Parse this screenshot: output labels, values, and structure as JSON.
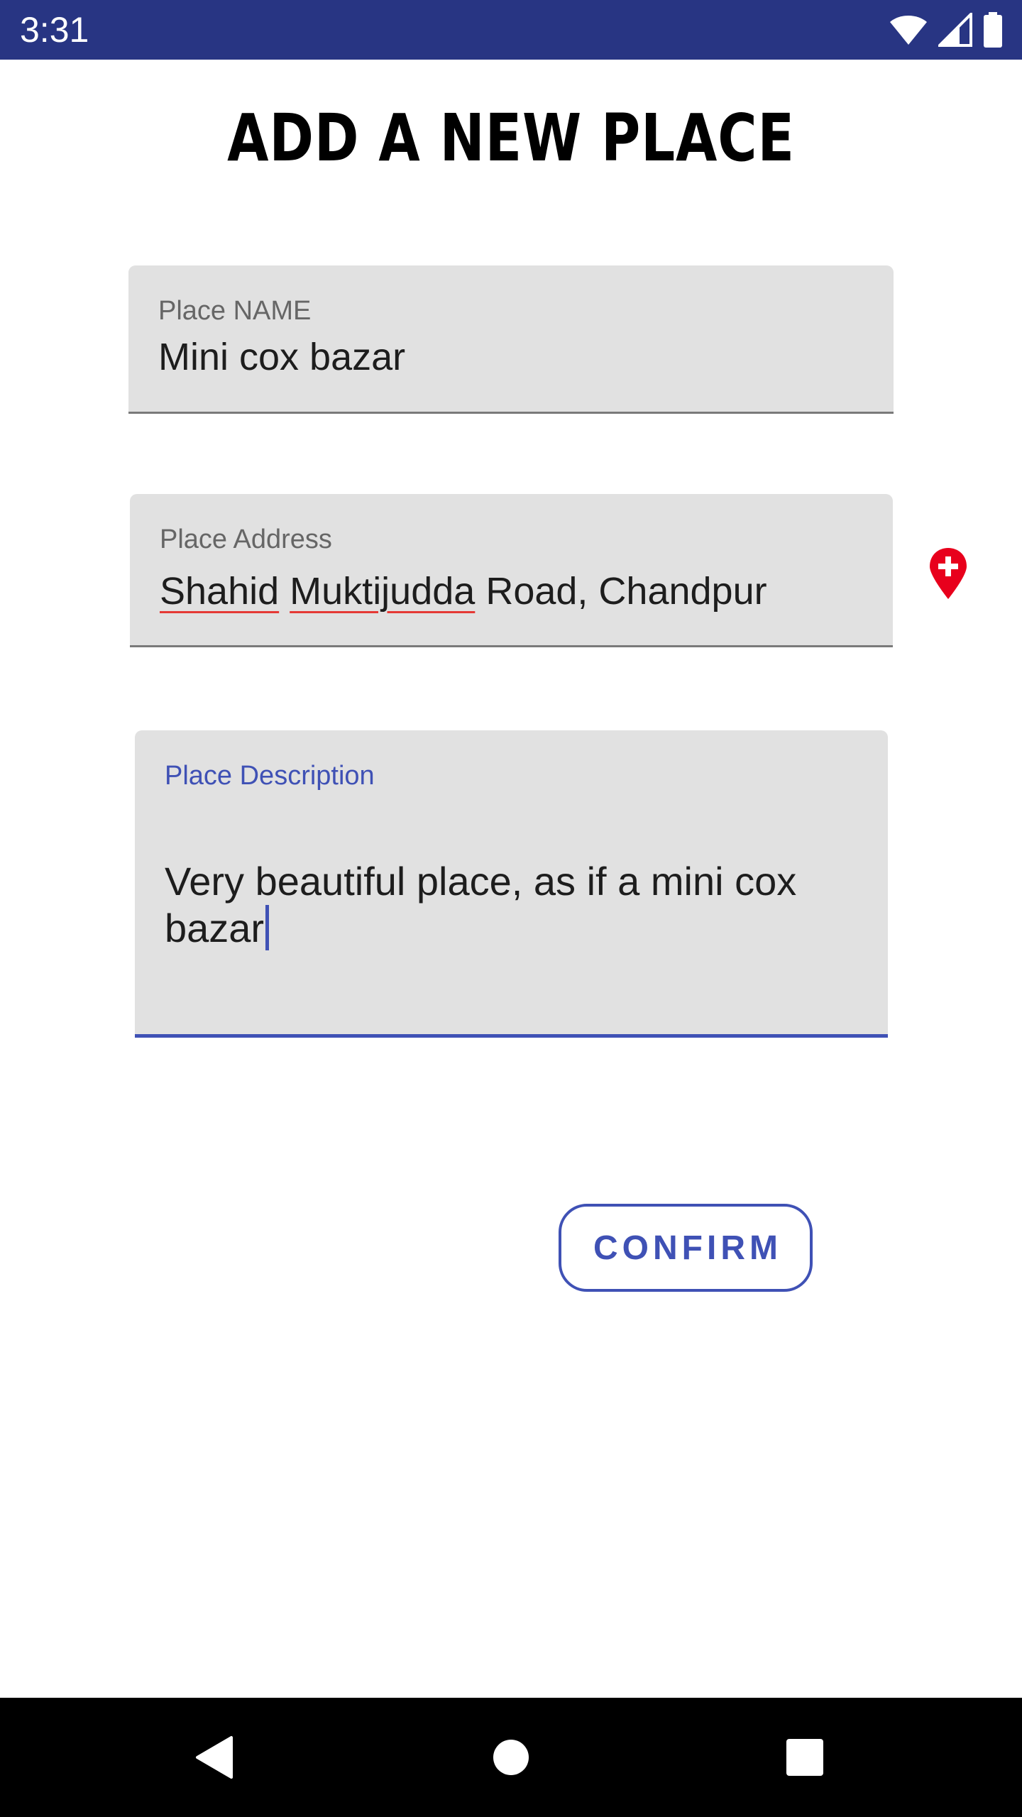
{
  "status_bar": {
    "time": "3:31",
    "icons": [
      "wifi-icon",
      "signal-icon",
      "battery-icon"
    ],
    "background": "#283583"
  },
  "title": "ADD A NEW PLACE",
  "name_field": {
    "label": "Place NAME",
    "value": "Mini cox bazar"
  },
  "address_field": {
    "label": "Place Address",
    "value_parts": [
      "Shahid",
      "Muktijudda",
      "Road, Chandpur"
    ],
    "pin_icon": "add-location-icon",
    "pin_color": "#e8001c"
  },
  "description_field": {
    "label": "Place Description",
    "value": "Very beautiful place, as if a mini cox bazar",
    "focused": true,
    "accent": "#3f51b5"
  },
  "confirm_button": {
    "label": "CONFIRM"
  },
  "nav_bar": {
    "back": "back-icon",
    "home": "home-icon",
    "recents": "recents-icon"
  }
}
